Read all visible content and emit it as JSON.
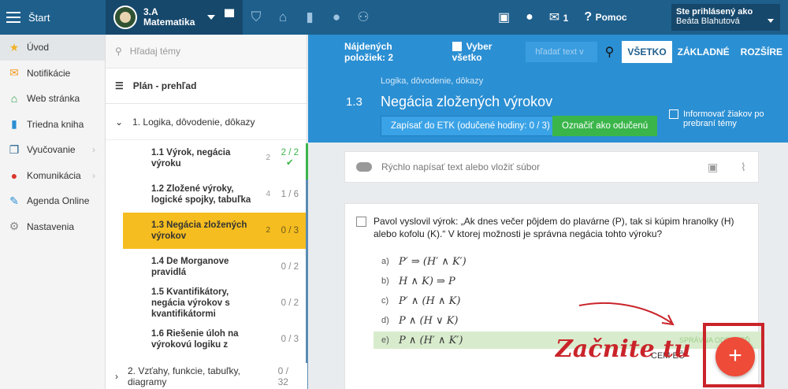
{
  "topbar": {
    "start_label": "Štart",
    "class_code": "3.A",
    "class_subject": "Matematika",
    "notif_count": "1",
    "help_label": "Pomoc",
    "user_line1": "Ste prihlásený ako",
    "user_line2": "Beáta Blahutová",
    "icons": [
      "briefcase-icon",
      "shield-icon",
      "bank-icon",
      "bar-chart-icon",
      "badge-icon",
      "people-icon",
      "presentation-icon",
      "chat-icon",
      "mail-icon",
      "question-icon"
    ]
  },
  "sidebar": {
    "items": [
      {
        "label": "Úvod",
        "icon": "star-icon"
      },
      {
        "label": "Notifikácie",
        "icon": "envelope-icon"
      },
      {
        "label": "Web stránka",
        "icon": "house-icon"
      },
      {
        "label": "Triedna kniha",
        "icon": "book-icon"
      },
      {
        "label": "Vyučovanie",
        "icon": "open-book-icon"
      },
      {
        "label": "Komunikácia",
        "icon": "bubble-icon"
      },
      {
        "label": "Agenda Online",
        "icon": "pen-icon"
      },
      {
        "label": "Nastavenia",
        "icon": "gear-icon"
      }
    ]
  },
  "tree": {
    "search_placeholder": "Hľadaj témy",
    "plan_label": "Plán - prehľad",
    "chapter1": "1. Logika, dôvodenie, dôkazy",
    "chapter2": "2. Vzťahy, funkcie, tabuľky, diagramy",
    "chapter2_progress": "0 / 32",
    "subtopics": [
      {
        "title": "1.1 Výrok, negácia výroku",
        "count": "2",
        "progress": "2 / 2"
      },
      {
        "title": "1.2 Zložené výroky, logické spojky, tabuľka",
        "count": "4",
        "progress": "1 / 6"
      },
      {
        "title": "1.3 Negácia zložených výrokov",
        "count": "2",
        "progress": "0 / 3"
      },
      {
        "title": "1.4 De Morganove pravidlá",
        "count": "",
        "progress": "0 / 2"
      },
      {
        "title": "1.5 Kvantifikátory, negácia výrokov s kvantifikátormi",
        "count": "",
        "progress": "0 / 2"
      },
      {
        "title": "1.6 Riešenie úloh na výrokovú logiku z",
        "count": "",
        "progress": "0 / 3"
      }
    ]
  },
  "main": {
    "found": "Nájdených položiek: 2",
    "select_all": "Vyber všetko",
    "search_placeholder": "hľadať text v",
    "filters": [
      "VŠETKO",
      "ZÁKLADNÉ",
      "ROZŠÍRE"
    ],
    "crumb": "Logika, dôvodenie, dôkazy",
    "topic_num": "1.3",
    "topic_title": "Negácia zložených výrokov",
    "btn_etk": "Zapísať do ETK (odučené hodiny: 0 / 3)",
    "btn_done": "Označiť ako odučenú",
    "inform_label": "Informovať žiakov po prebraní témy",
    "quick_placeholder": "Rýchlo napísať text alebo vložiť súbor",
    "question": "Pavol vyslovil výrok: „Ak dnes večer pôjdem do plavárne (P), tak si kúpim hranolky (H) alebo kofolu (K).“ V ktorej možnosti je správna negácia tohto výroku?",
    "answers": [
      {
        "letter": "a)",
        "formula": "P′ ⇒ (H′ ∧ K′)"
      },
      {
        "letter": "b)",
        "formula": "H ∧ K) ⇒ P"
      },
      {
        "letter": "c)",
        "formula": "P′ ∧ (H ∧ K)"
      },
      {
        "letter": "d)",
        "formula": "P ∧ (H ∨ K)"
      },
      {
        "letter": "e)",
        "formula": "P ∧ (H′ ∧ K′)"
      }
    ],
    "correct_label": "SPRÁVNA ODPOVEĎ",
    "partial_text": "CEM EČ",
    "annotation": "Začnite tu",
    "fab_label": "+"
  }
}
